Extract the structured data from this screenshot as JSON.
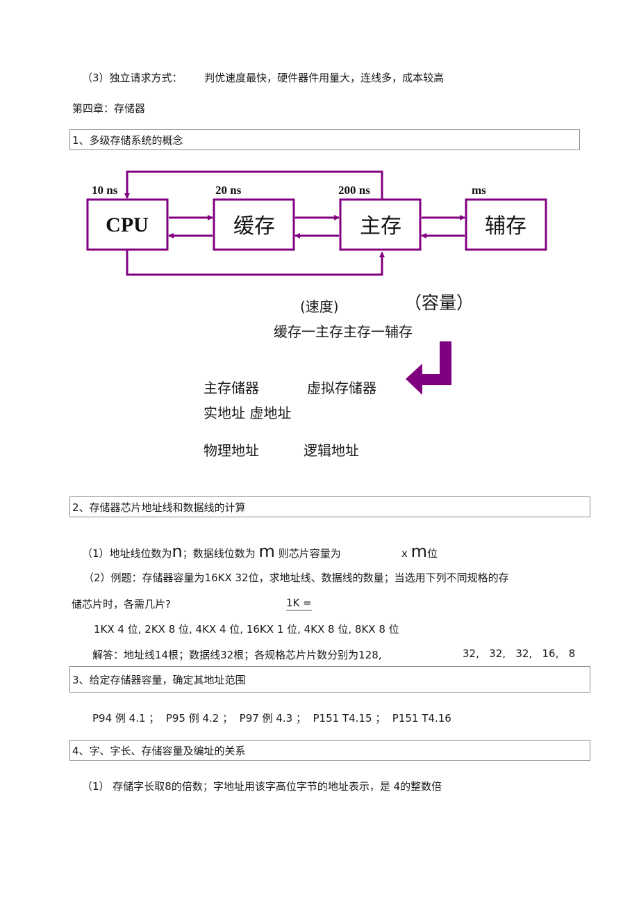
{
  "intro_line": {
    "label": "（3）独立请求方式：",
    "text": "判优速度最快，硬件器件用量大，连线多，成本较高"
  },
  "chapter_title": "第四章：存储器",
  "sections": [
    {
      "title": "1、多级存储系统的概念"
    },
    {
      "title": "2、存储器芯片地址线和数据线的计算"
    },
    {
      "title": "3、给定存储器容量，确定其地址范围"
    },
    {
      "title": "4、字、字长、存储容量及编址的关系"
    }
  ],
  "diagram": {
    "accent_color": "#800080",
    "nodes": [
      {
        "label": "CPU",
        "timing": "10 ns"
      },
      {
        "label": "缓存",
        "timing": "20 ns"
      },
      {
        "label": "主存",
        "timing": "200 ns"
      },
      {
        "label": "辅存",
        "timing": "ms"
      }
    ]
  },
  "hierarchy": {
    "speed_label": "(速度)",
    "capacity_label": "（容量）",
    "levels_line": "缓存一主存主存一辅存",
    "row1": [
      "主存储器",
      "虚拟存储器"
    ],
    "row2": "实地址 虚地址",
    "row3": [
      "物理地址",
      "逻辑地址"
    ]
  },
  "section2": {
    "item1_prefix": "（1）地址线位数为",
    "item1_n": "n",
    "item1_mid": "；数据线位数为 ",
    "item1_m": "m",
    "item1_after": " 则芯片容量为",
    "item1_x": "x ",
    "item1_m2": "m",
    "item1_end": "位",
    "item2_line1": "（2）例题：存储器容量为16KX 32位，求地址线、数据线的数量；当选用下列不同规格的存",
    "item2_line2": "储芯片时，各需几片?",
    "k_eq": "1K =",
    "specs": "1KX 4 位, 2KX 8 位, 4KX 4 位, 16KX 1 位, 4KX 8 位, 8KX 8 位",
    "answer": "解答：地址线14根；数据线32根；各规格芯片片数分别为128,",
    "answer_rest": "32,   32,   32,   16,   8"
  },
  "section3": {
    "refs": "P94 例 4.1 ；  P95 例 4.2 ；  P97 例 4.3 ；  P151 T4.15 ；  P151 T4.16"
  },
  "section4": {
    "item1": "（1）  存储字长取8的倍数；字地址用该字高位字节的地址表示，是 4的整数倍"
  }
}
